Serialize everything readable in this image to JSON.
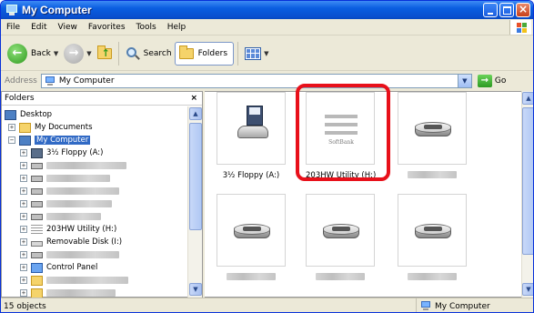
{
  "window": {
    "title": "My Computer"
  },
  "menu": [
    "File",
    "Edit",
    "View",
    "Favorites",
    "Tools",
    "Help"
  ],
  "toolbar": {
    "back": "Back",
    "search": "Search",
    "folders": "Folders"
  },
  "address": {
    "label": "Address",
    "value": "My Computer",
    "go": "Go"
  },
  "folders_pane": {
    "title": "Folders",
    "close": "×",
    "tree": [
      {
        "label": "Desktop"
      },
      {
        "label": "My Documents"
      },
      {
        "label": "My Computer",
        "selected": true
      },
      {
        "label": "3½ Floppy (A:)"
      },
      {
        "label": "203HW Utility (H:)"
      },
      {
        "label": "Removable Disk (I:)"
      },
      {
        "label": "Control Panel"
      }
    ]
  },
  "items": [
    {
      "label": "3½ Floppy (A:)",
      "icon": "floppy-drive-icon"
    },
    {
      "label": "203HW Utility (H:)",
      "icon": "softbank-drive-icon",
      "logo_text": "SoftBank"
    },
    {
      "label": "",
      "icon": "drive-icon"
    },
    {
      "label": "",
      "icon": "drive-icon"
    },
    {
      "label": "",
      "icon": "drive-icon"
    },
    {
      "label": "",
      "icon": "drive-icon"
    }
  ],
  "status": {
    "objects": "15 objects",
    "location": "My Computer"
  },
  "colors": {
    "titlebar": "#0a5ee0",
    "selection": "#316ac5",
    "highlight": "#e8101a"
  }
}
